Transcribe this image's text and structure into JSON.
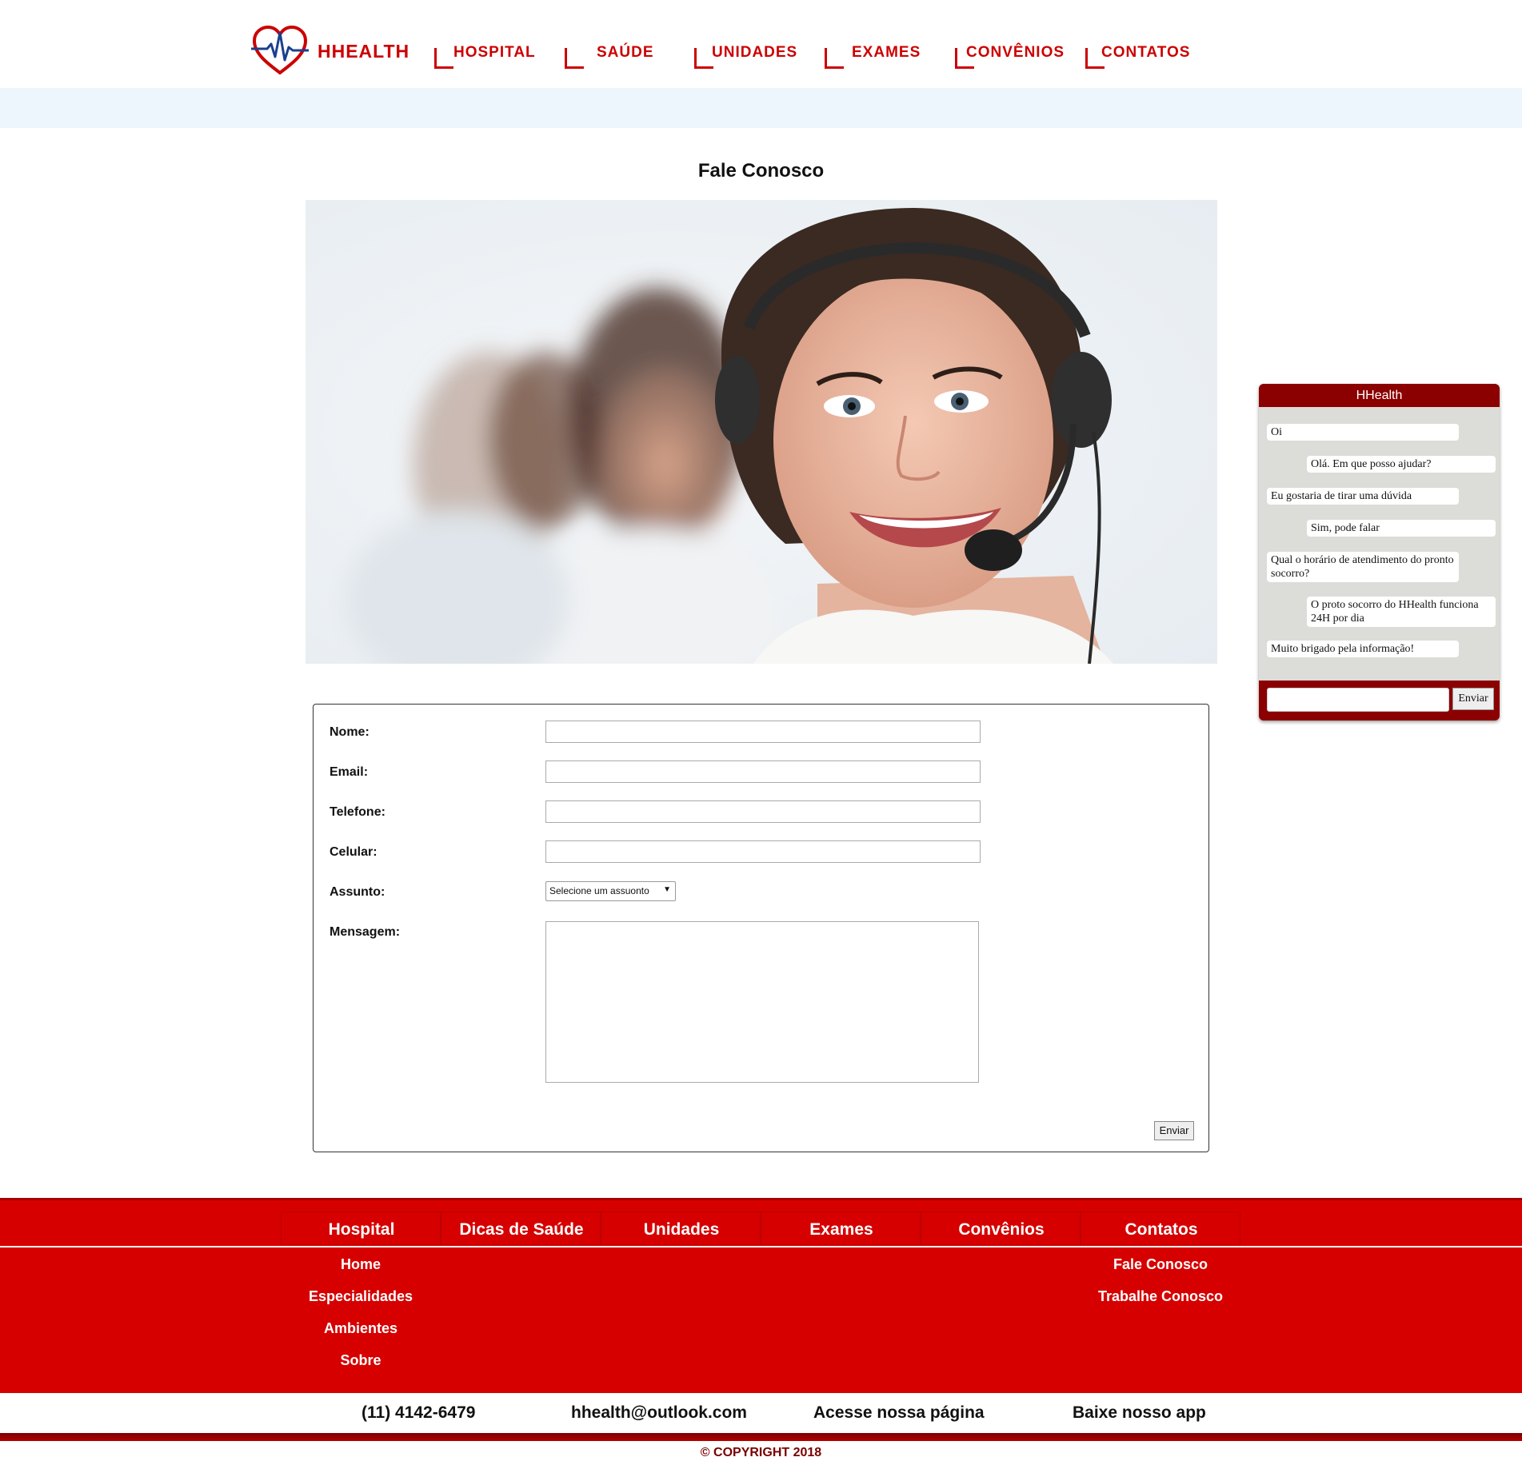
{
  "header": {
    "brand": "HHEALTH",
    "nav": [
      "HOSPITAL",
      "SAÚDE",
      "UNIDADES",
      "EXAMES",
      "CONVÊNIOS",
      "CONTATOS"
    ]
  },
  "main": {
    "title": "Fale Conosco"
  },
  "form": {
    "labels": {
      "name": "Nome:",
      "email": "Email:",
      "phone": "Telefone:",
      "mobile": "Celular:",
      "subject": "Assunto:",
      "message": "Mensagem:"
    },
    "subject_selected": "Selecione um assuonto",
    "submit": "Enviar"
  },
  "chat": {
    "title": "HHealth",
    "messages": [
      {
        "from": "user",
        "text": "Oi"
      },
      {
        "from": "bot",
        "text": "Olá. Em que posso ajudar?"
      },
      {
        "from": "user",
        "text": "Eu gostaria de tirar uma dúvida"
      },
      {
        "from": "bot",
        "text": "Sim, pode falar"
      },
      {
        "from": "user",
        "text": "Qual o horário de atendimento do pronto socorro?"
      },
      {
        "from": "bot",
        "text": "O proto socorro do HHealth funciona 24H por dia"
      },
      {
        "from": "user",
        "text": "Muito brigado pela informação!"
      }
    ],
    "send": "Enviar"
  },
  "footer": {
    "columns": [
      {
        "title": "Hospital",
        "links": [
          "Home",
          "Especialidades",
          "Ambientes",
          "Sobre"
        ]
      },
      {
        "title": "Dicas de Saúde",
        "links": []
      },
      {
        "title": "Unidades",
        "links": []
      },
      {
        "title": "Exames",
        "links": []
      },
      {
        "title": "Convênios",
        "links": []
      },
      {
        "title": "Contatos",
        "links": [
          "Fale Conosco",
          "Trabalhe Conosco"
        ]
      }
    ],
    "contact": {
      "phone": "(11) 4142-6479",
      "email": "hhealth@outlook.com",
      "page": "Acesse nossa página",
      "app": "Baixe nosso app"
    },
    "copyright": "© COPYRIGHT 2018"
  },
  "colors": {
    "brand_red": "#cc0000",
    "footer_red": "#d60000",
    "chat_dark_red": "#8b0000",
    "subbar_blue": "#eef6fd"
  }
}
